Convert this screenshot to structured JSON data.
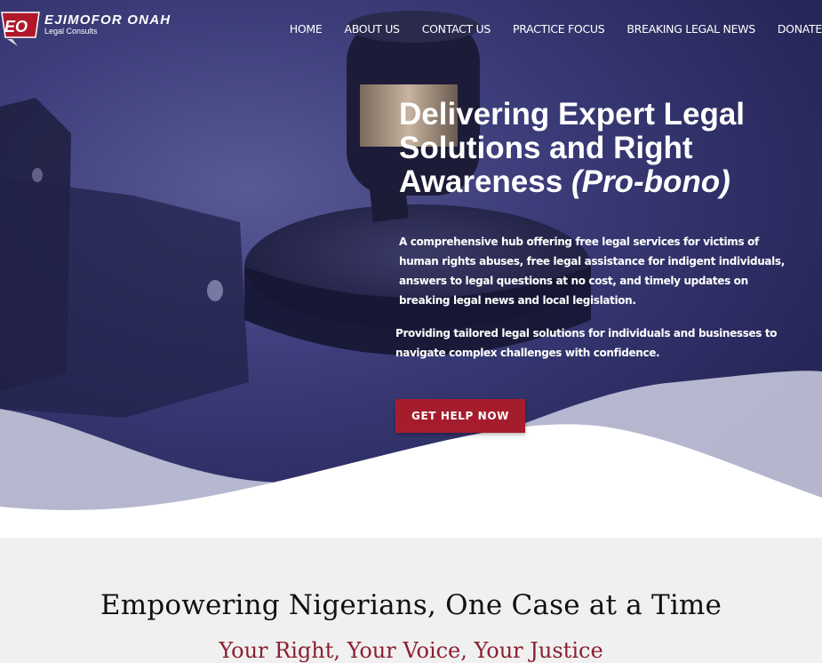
{
  "header": {
    "logo_mark": "EO",
    "logo_name": "EJIMOFOR ONAH",
    "logo_sub": "Legal Consults"
  },
  "nav": {
    "items": [
      "HOME",
      "ABOUT US",
      "CONTACT US",
      "PRACTICE FOCUS",
      "BREAKING LEGAL NEWS",
      "DONATE"
    ]
  },
  "hero": {
    "title_main": "Delivering Expert Legal Solutions and Right Awareness",
    "title_em": "(Pro-bono)",
    "description": "A comprehensive hub offering free legal services for victims of human rights abuses, free legal assistance for indigent individuals, answers to legal questions at no cost, and timely updates on breaking legal news and local legislation.",
    "description2": "Providing tailored legal solutions for individuals and businesses to navigate complex challenges with confidence.",
    "cta_label": "GET HELP NOW"
  },
  "section2": {
    "title": "Empowering Nigerians, One Case at a Time",
    "subtitle": "Your Right, Your Voice, Your Justice"
  },
  "colors": {
    "accent": "#a51d2d",
    "hero_bg": "#2c2c63",
    "subtitle": "#8a1f2e"
  }
}
